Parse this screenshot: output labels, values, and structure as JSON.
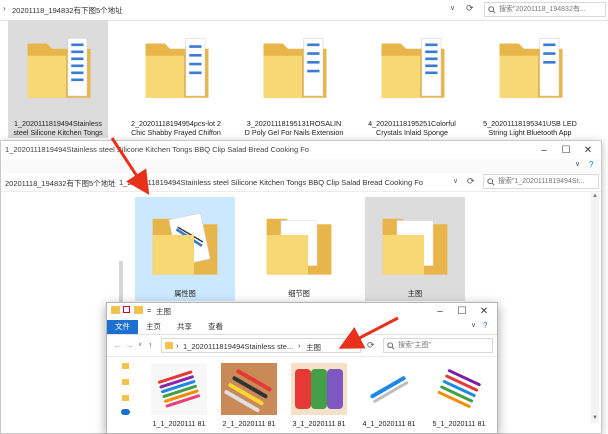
{
  "window1": {
    "breadcrumb": "20201118_194832有下图5个地址",
    "search_placeholder": "搜索\"20201118_194832有...",
    "folders": [
      {
        "caption_line1": "1_2020111819494Stainless",
        "caption_line2": "steel Silicone Kitchen Tongs"
      },
      {
        "caption_line1": "2_20201118194954pcs-lot 2",
        "caption_line2": "Chic Shabby Frayed Chiffon"
      },
      {
        "caption_line1": "3_20201118195131ROSALIN",
        "caption_line2": "D Poly Gel For Nails Extension"
      },
      {
        "caption_line1": "4_20201118195251Colorful",
        "caption_line2": "Crystals Inlaid Sponge"
      },
      {
        "caption_line1": "5_20201118195341USB LED",
        "caption_line2": "String Light Bluetooth App"
      }
    ]
  },
  "window2": {
    "title": "1_2020111819494Stainless steel Silicone Kitchen Tongs BBQ Clip Salad Bread Cooking Fo",
    "crumb_parent": "20201118_194832有下图5个地址",
    "crumb_sep": "›",
    "crumb_current": "1_2020111819494Stainless steel Silicone Kitchen Tongs BBQ Clip Salad Bread Cooking Fo",
    "search_placeholder": "搜索\"1_2020111819494St...",
    "folders": [
      {
        "label": "属性图"
      },
      {
        "label": "细节图"
      },
      {
        "label": "主图"
      }
    ]
  },
  "window3": {
    "title": "主图",
    "title_prefix": "=",
    "tabs": [
      "文件",
      "主页",
      "共享",
      "查看"
    ],
    "crumb_parent": "1_2020111819494Stainless ste...",
    "crumb_sep": "›",
    "crumb_current": "主图",
    "search_placeholder": "搜索\"主图\"",
    "images": [
      {
        "caption": "1_1_2020111 81"
      },
      {
        "caption": "2_1_2020111 81"
      },
      {
        "caption": "3_1_2020111 81"
      },
      {
        "caption": "4_1_2020111 81"
      },
      {
        "caption": "5_1_2020111 81"
      }
    ]
  },
  "colors": {
    "accent_blue": "#1e6fd2",
    "selection": "#cce8ff",
    "folder_yellow": "#f8d775",
    "arrow_red": "#e8311a"
  }
}
